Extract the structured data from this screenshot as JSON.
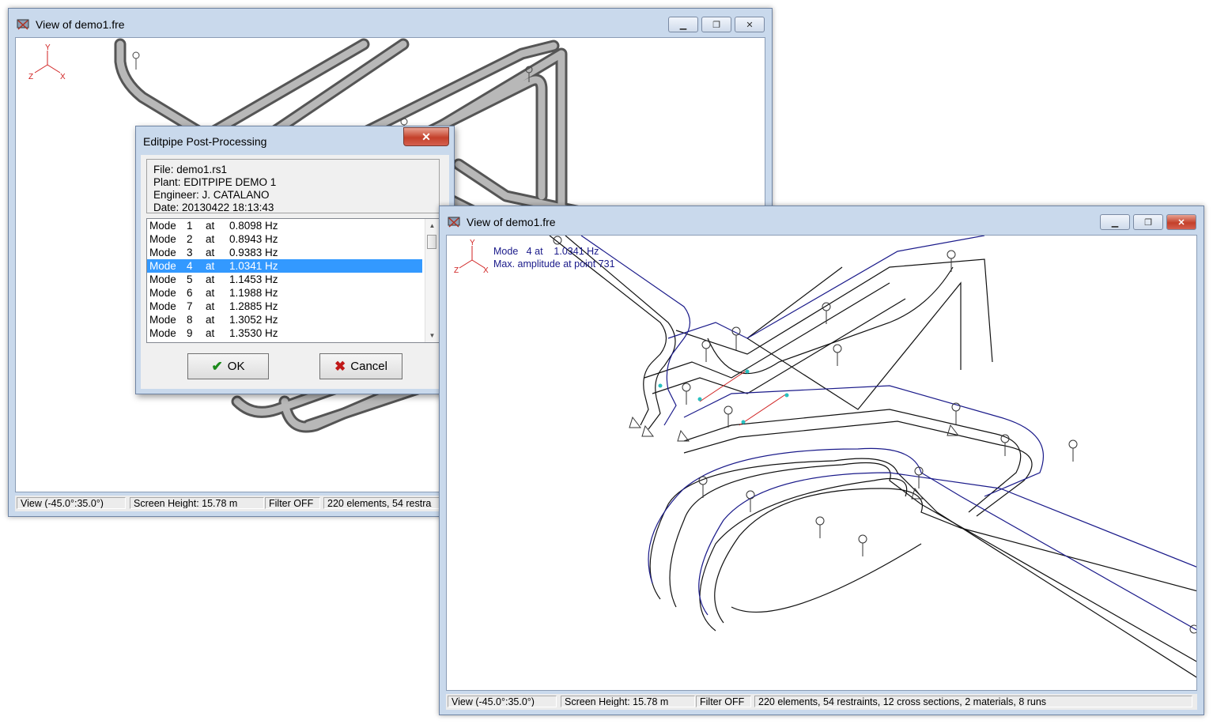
{
  "back_window": {
    "title": "View of demo1.fre",
    "status": {
      "view": "View (-45.0°:35.0°)",
      "screen_height": "Screen Height: 15.78 m",
      "filter": "Filter OFF",
      "counts": "220 elements, 54 restra"
    }
  },
  "dialog": {
    "title": "Editpipe Post-Processing",
    "close_label": "✕",
    "info": {
      "file": "File: demo1.rs1",
      "plant": "Plant: EDITPIPE DEMO 1",
      "engineer": "Engineer: J. CATALANO",
      "date": "Date: 20130422  18:13:43"
    },
    "modes": [
      {
        "label": "Mode",
        "num": "1",
        "freq": "at     0.8098 Hz"
      },
      {
        "label": "Mode",
        "num": "2",
        "freq": "at     0.8943 Hz"
      },
      {
        "label": "Mode",
        "num": "3",
        "freq": "at     0.9383 Hz"
      },
      {
        "label": "Mode",
        "num": "4",
        "freq": "at     1.0341 Hz"
      },
      {
        "label": "Mode",
        "num": "5",
        "freq": "at     1.1453 Hz"
      },
      {
        "label": "Mode",
        "num": "6",
        "freq": "at     1.1988 Hz"
      },
      {
        "label": "Mode",
        "num": "7",
        "freq": "at     1.2885 Hz"
      },
      {
        "label": "Mode",
        "num": "8",
        "freq": "at     1.3052 Hz"
      },
      {
        "label": "Mode",
        "num": "9",
        "freq": "at     1.3530 Hz"
      }
    ],
    "selected_index": 3,
    "ok_label": "OK",
    "cancel_label": "Cancel"
  },
  "front_window": {
    "title": "View of demo1.fre",
    "overlay": {
      "mode_line": "Mode   4 at    1.0341 Hz",
      "amplitude_line": "Max. amplitude at point 731"
    },
    "status": {
      "view": "View (-45.0°:35.0°)",
      "screen_height": "Screen Height: 15.78 m",
      "filter": "Filter OFF",
      "counts": "220 elements, 54 restraints, 12 cross sections, 2 materials, 8 runs"
    }
  },
  "axis_labels": {
    "y": "Y",
    "z": "Z",
    "x": "X"
  },
  "colors": {
    "title_bg": "#c9d9ec",
    "selection": "#3399ff",
    "mode_shape": "#1a1a8a",
    "axis": "#d02020"
  }
}
